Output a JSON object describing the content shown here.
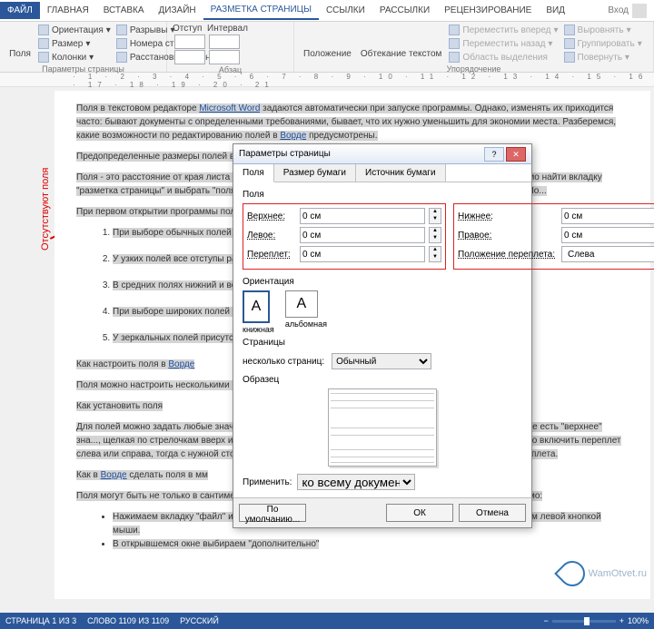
{
  "tabs": {
    "file": "ФАЙЛ",
    "home": "ГЛАВНАЯ",
    "insert": "ВСТАВКА",
    "design": "ДИЗАЙН",
    "layout": "РАЗМЕТКА СТРАНИЦЫ",
    "references": "ССЫЛКИ",
    "mailings": "РАССЫЛКИ",
    "review": "РЕЦЕНЗИРОВАНИЕ",
    "view": "ВИД"
  },
  "login": "Вход",
  "ribbon": {
    "margins": "Поля",
    "orientation": "Ориентация",
    "size": "Размер",
    "columns": "Колонки",
    "breaks": "Разрывы",
    "lineno": "Номера строк",
    "hyphen": "Расстановка переносов",
    "group_page": "Параметры страницы",
    "indent": "Отступ",
    "spacing": "Интервал",
    "group_para": "Абзац",
    "position": "Положение",
    "wrap": "Обтекание текстом",
    "forward": "Переместить вперед",
    "backward": "Переместить назад",
    "selpane": "Область выделения",
    "align": "Выровнять",
    "group_cmd": "Группировать",
    "rotate": "Повернуть",
    "group_arrange": "Упорядочение"
  },
  "side_note": "Отсутствуют поля",
  "doc": {
    "p1a": "Поля в текстовом редакторе ",
    "p1_link1": "Microsoft Word",
    "p1b": " задаются автоматически при запуске программы. Однако, изменять их приходится часто: бывают документы с определенными требованиями, бывает, что их нужно уменьшить для экономии места. Разберемся, какие возможности по редактированию полей в ",
    "p1_link2": "Ворде",
    "p1c": " предусмотрены.",
    "p2": "Предопределенные размеры полей в Ворде",
    "p3": "Поля - это расстояние от края листа до текста. Справа, слева, сверху и снизу. Для их изменения необходимо найти вкладку \"разметка страницы\" и выбрать \"поля\". В открывшемся окне находится кнопка \"поля\", которая нам нужна. По...",
    "p4": "При первом открытии программы поля...",
    "li1": "При выборе обычных полей отступ слева будет ... полтора.",
    "li2": "У узких полей все отступы ра...",
    "li3": "В средних полях нижний и верх...",
    "li4": "При выборе широких полей от...",
    "li5": "У зеркальных полей присутст... сантиметра.",
    "h1a": "Как настроить поля в ",
    "h1link": "Ворде",
    "p5": "Поля можно настроить несколькими ...",
    "h2": "Как установить поля",
    "p6": "Для полей можно задать любые значения... В ней содержатся \"параметры страницы\", в... открывшемся окне есть \"верхнее\" зна..., щелкая по стрелочкам вверх и вниз, а можно вы... \"нижнее\", \"левое\" и \"правое\" значение поля. Можно включить переплет слева или справа, тогда с нужной стороны отступ будет не только на значение поля, но и на значение переплета.",
    "h3a": "Как в ",
    "h3link": "Ворде",
    "h3b": " сделать поля в мм",
    "p7": "Поля могут быть не только в сантиметрах, но и в других единицах измерения. Для их изменения необходимо:",
    "b1": "Нажимаем вкладку \"файл\" и спускаемся вниз, предпоследними стоят \"параметры\", щелкаем по ним левой кнопкой мыши.",
    "b2": "В открывшемся окне выбираем \"дополнительно\""
  },
  "watermark": "WamOtvet.ru",
  "dialog": {
    "title": "Параметры страницы",
    "tab_fields": "Поля",
    "tab_paper": "Размер бумаги",
    "tab_source": "Источник бумаги",
    "section_fields": "Поля",
    "top": "Верхнее:",
    "bottom": "Нижнее:",
    "left": "Левое:",
    "right": "Правое:",
    "gutter": "Переплет:",
    "gutter_pos": "Положение переплета:",
    "val_zero": "0 см",
    "gutter_pos_val": "Слева",
    "orientation": "Ориентация",
    "portrait": "книжная",
    "landscape": "альбомная",
    "pages": "Страницы",
    "multi": "несколько страниц:",
    "multi_val": "Обычный",
    "sample": "Образец",
    "apply": "Применить:",
    "apply_val": "ко всему документу",
    "default_btn": "По умолчанию...",
    "ok": "ОК",
    "cancel": "Отмена"
  },
  "status": {
    "page": "СТРАНИЦА 1 ИЗ 3",
    "words": "СЛОВО 1109 ИЗ 1109",
    "lang": "РУССКИЙ",
    "zoom": "100%"
  }
}
